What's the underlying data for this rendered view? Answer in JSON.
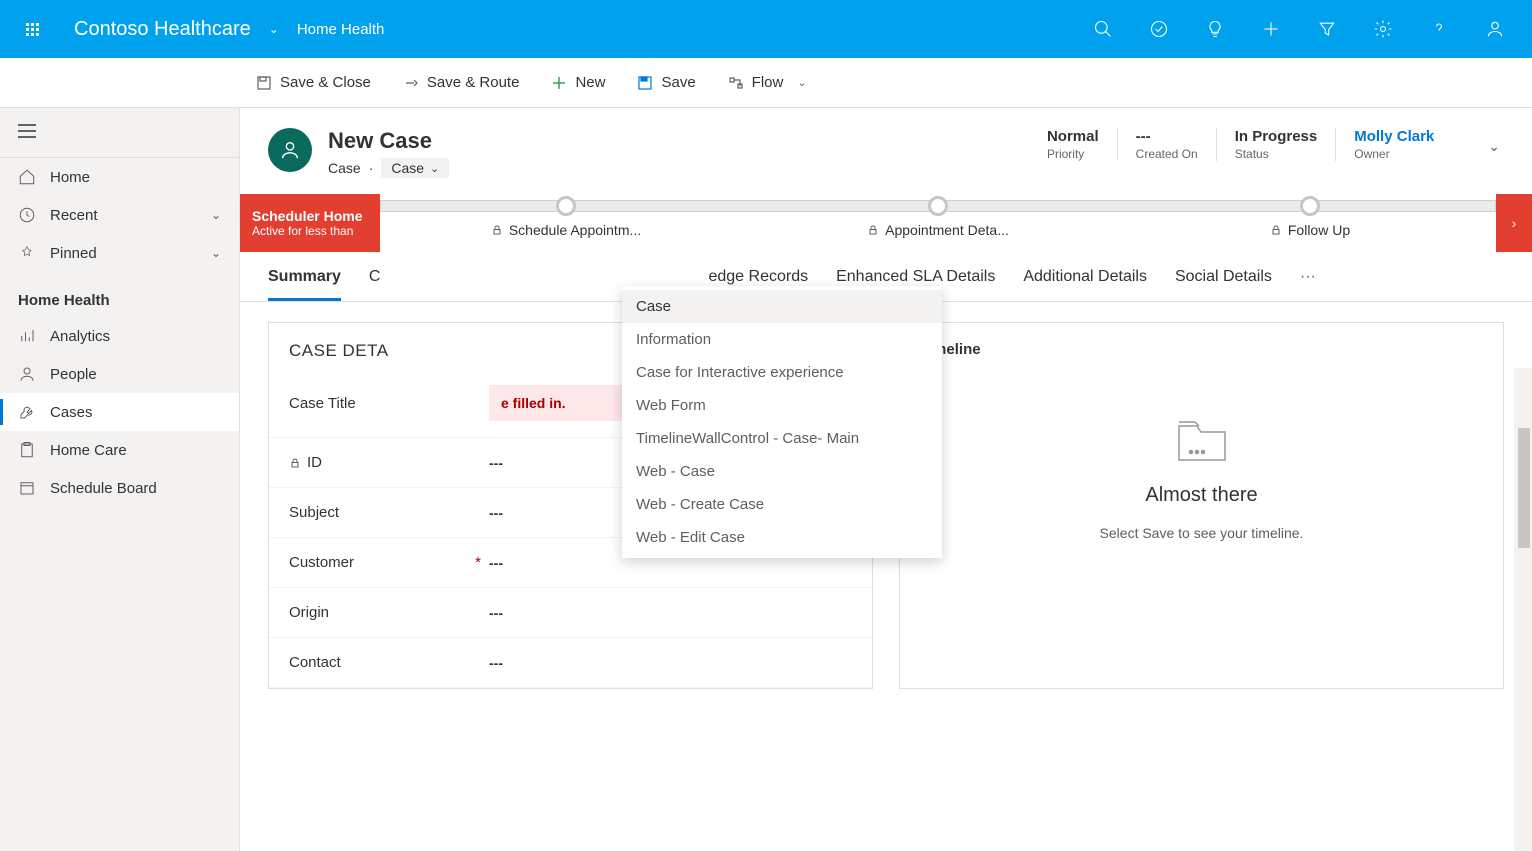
{
  "topbar": {
    "app_name": "Contoso Healthcare",
    "area": "Home Health"
  },
  "commands": {
    "save_close": "Save & Close",
    "save_route": "Save & Route",
    "new": "New",
    "save": "Save",
    "flow": "Flow"
  },
  "nav": {
    "home": "Home",
    "recent": "Recent",
    "pinned": "Pinned",
    "section": "Home Health",
    "analytics": "Analytics",
    "people": "People",
    "cases": "Cases",
    "home_care": "Home Care",
    "schedule_board": "Schedule Board"
  },
  "record": {
    "title": "New Case",
    "entity": "Case",
    "form_selected": "Case",
    "header_fields": [
      {
        "value": "Normal",
        "label": "Priority"
      },
      {
        "value": "---",
        "label": "Created On"
      },
      {
        "value": "In Progress",
        "label": "Status"
      },
      {
        "value": "Molly Clark",
        "label": "Owner",
        "link": true
      }
    ]
  },
  "scheduler_banner": {
    "title": "Scheduler Home",
    "sub": "Active for less than"
  },
  "bpf_stages": [
    "Schedule Appointm...",
    "Appointment Deta...",
    "Follow Up"
  ],
  "form_menu": [
    "Case",
    "Information",
    "Case for Interactive experience",
    "Web Form",
    "TimelineWallControl - Case- Main",
    "Web - Case",
    "Web - Create Case",
    "Web - Edit Case"
  ],
  "tabs": [
    "Summary",
    "C",
    "edge Records",
    "Enhanced SLA Details",
    "Additional Details",
    "Social Details"
  ],
  "case_details": {
    "section_title": "CASE DETA",
    "fields": [
      {
        "label": "Case Title",
        "error": "e filled in.",
        "required": true
      },
      {
        "label": "ID",
        "value": "---",
        "locked": true
      },
      {
        "label": "Subject",
        "value": "---"
      },
      {
        "label": "Customer",
        "value": "---",
        "required": true
      },
      {
        "label": "Origin",
        "value": "---"
      },
      {
        "label": "Contact",
        "value": "---"
      }
    ]
  },
  "timeline": {
    "title": "Timeline",
    "empty_title": "Almost there",
    "empty_sub": "Select Save to see your timeline."
  }
}
